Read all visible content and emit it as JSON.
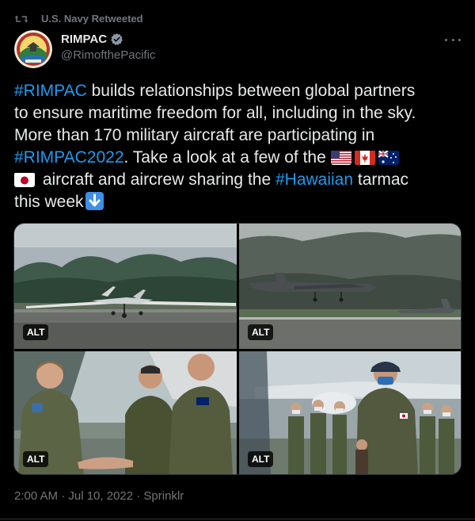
{
  "retweet": {
    "label": "U.S. Navy Retweeted"
  },
  "author": {
    "name": "RIMPAC",
    "handle": "@RimofthePacific",
    "avatar_icon": "rimpac-logo-icon",
    "verified_icon": "verified-badge-icon"
  },
  "tweet": {
    "segments": {
      "l1a": "#RIMPAC",
      "l1b": " builds relationships between global partners",
      "l2": "to ensure maritime freedom for all, including in the sky.",
      "l3": "More than 170 military aircraft are participating in",
      "l4a": "#RIMPAC2022",
      "l4b": ". Take a look at a few of the ",
      "l5a": " aircraft and aircrew sharing the ",
      "l5b": "#Hawaiian",
      "l5c": " tarmac",
      "l6": "this week"
    },
    "flags": [
      "us-flag-icon",
      "canada-flag-icon",
      "australia-flag-icon",
      "japan-flag-icon"
    ],
    "arrow_icon": "down-arrow-emoji-icon"
  },
  "media": {
    "alt_label": "ALT",
    "photos": [
      "drone-on-runway-photo",
      "patrol-aircraft-landing-photo",
      "aircrew-handshake-photo",
      "aircrew-group-photo"
    ]
  },
  "meta": {
    "timestamp": "2:00 AM · Jul 10, 2022 · Sprinklr"
  },
  "colors": {
    "background": "#000000",
    "link": "#1d9bf0",
    "muted": "#71767b",
    "text": "#e7e9ea"
  }
}
